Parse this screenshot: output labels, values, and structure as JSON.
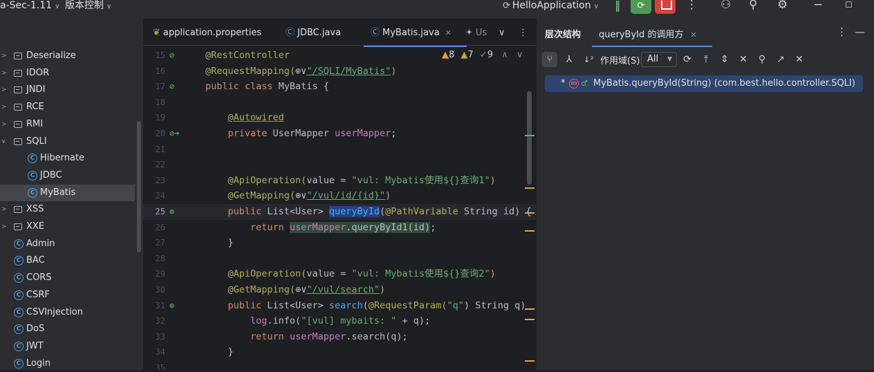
{
  "titlebar": {
    "project": "a-Sec-1.11",
    "vcs": "版本控制",
    "run_config": "HelloApplication",
    "icons": [
      "run-config-icon",
      "pause-icon",
      "debug-icon",
      "stop-icon",
      "more-icon",
      "add-user-icon",
      "search-icon",
      "settings-icon",
      "minimize-icon",
      "maximize-icon"
    ]
  },
  "project_tree": [
    {
      "label": "Deserialize",
      "type": "folder",
      "indent": 1,
      "expanded": false
    },
    {
      "label": "IDOR",
      "type": "folder",
      "indent": 1,
      "expanded": false
    },
    {
      "label": "JNDI",
      "type": "folder",
      "indent": 1,
      "expanded": false
    },
    {
      "label": "RCE",
      "type": "folder",
      "indent": 1,
      "expanded": false
    },
    {
      "label": "RMI",
      "type": "folder",
      "indent": 1,
      "expanded": false
    },
    {
      "label": "SQLI",
      "type": "folder",
      "indent": 1,
      "expanded": true
    },
    {
      "label": "Hibernate",
      "type": "class",
      "indent": 2
    },
    {
      "label": "JDBC",
      "type": "class",
      "indent": 2
    },
    {
      "label": "MyBatis",
      "type": "class",
      "indent": 2,
      "selected": true
    },
    {
      "label": "XSS",
      "type": "folder",
      "indent": 1,
      "expanded": false
    },
    {
      "label": "XXE",
      "type": "folder",
      "indent": 1,
      "expanded": false
    },
    {
      "label": "Admin",
      "type": "class",
      "indent": 1
    },
    {
      "label": "BAC",
      "type": "class",
      "indent": 1
    },
    {
      "label": "CORS",
      "type": "class",
      "indent": 1
    },
    {
      "label": "CSRF",
      "type": "class",
      "indent": 1
    },
    {
      "label": "CSVInjection",
      "type": "class",
      "indent": 1
    },
    {
      "label": "DoS",
      "type": "class",
      "indent": 1
    },
    {
      "label": "JWT",
      "type": "class",
      "indent": 1
    },
    {
      "label": "Login",
      "type": "class",
      "indent": 1
    }
  ],
  "editor": {
    "tabs": [
      {
        "label": "application.properties",
        "icon": "spring-icon"
      },
      {
        "label": "JDBC.java",
        "icon": "class-icon"
      },
      {
        "label": "MyBatis.java",
        "icon": "class-icon",
        "active": true
      },
      {
        "label": "Us",
        "icon": "class-icon"
      }
    ],
    "inspections": {
      "warnings": "8",
      "weak_warnings": "7",
      "typos": "9"
    },
    "current_line": "25",
    "lines": [
      {
        "n": "15",
        "gutter": "bean-icon"
      },
      {
        "n": "16",
        "gutter": ""
      },
      {
        "n": "17",
        "gutter": "bean-icon"
      },
      {
        "n": "18",
        "gutter": ""
      },
      {
        "n": "19",
        "gutter": ""
      },
      {
        "n": "20",
        "gutter": "bean-autowire-icon"
      },
      {
        "n": "21",
        "gutter": ""
      },
      {
        "n": "22",
        "gutter": ""
      },
      {
        "n": "23",
        "gutter": ""
      },
      {
        "n": "24",
        "gutter": ""
      },
      {
        "n": "25",
        "gutter": "endpoint-icon"
      },
      {
        "n": "26",
        "gutter": ""
      },
      {
        "n": "27",
        "gutter": ""
      },
      {
        "n": "28",
        "gutter": ""
      },
      {
        "n": "29",
        "gutter": ""
      },
      {
        "n": "30",
        "gutter": ""
      },
      {
        "n": "31",
        "gutter": "endpoint-icon"
      },
      {
        "n": "32",
        "gutter": ""
      },
      {
        "n": "33",
        "gutter": ""
      },
      {
        "n": "34",
        "gutter": ""
      },
      {
        "n": "35",
        "gutter": ""
      }
    ],
    "code": {
      "l15": "@RestController",
      "l16_a": "@RequestMapping(",
      "l16_b": "\"/SQLI/MyBatis\"",
      "l16_c": ")",
      "l17_a": "public class ",
      "l17_b": "MyBatis {",
      "l19": "@Autowired",
      "l20_a": "private ",
      "l20_b": "UserMapper ",
      "l20_c": "userMapper",
      "l20_d": ";",
      "l23_a": "@ApiOperation(",
      "l23_b": "value = ",
      "l23_c": "\"vul: Mybatis使用${}查询1\"",
      "l23_d": ")",
      "l24_a": "@GetMapping(",
      "l24_b": "\"/vul/id/{id}\"",
      "l24_c": ")",
      "l25_a": "public ",
      "l25_b": "List<User> ",
      "l25_c": "queryById",
      "l25_d": "(",
      "l25_e": "@PathVariable ",
      "l25_f": "String id) {",
      "l26_a": "return ",
      "l26_b": "userMapper",
      "l26_c": ".queryById1(id)",
      "l26_d": ";",
      "l27": "}",
      "l29_a": "@ApiOperation(",
      "l29_b": "value = ",
      "l29_c": "\"vul: Mybatis使用${}查询2\"",
      "l29_d": ")",
      "l30_a": "@GetMapping(",
      "l30_b": "\"/vul/search\"",
      "l30_c": ")",
      "l31_a": "public ",
      "l31_b": "List<User> ",
      "l31_c": "search",
      "l31_d": "(",
      "l31_e": "@RequestParam(",
      "l31_f": "\"q\"",
      "l31_g": ") String q)",
      "l32_a": "log",
      "l32_b": ".info(",
      "l32_c": "\"[vul] mybaits: \"",
      "l32_d": " + q);",
      "l33_a": "return ",
      "l33_b": "userMapper",
      "l33_c": ".search(q);",
      "l34": "}"
    }
  },
  "hierarchy_panel": {
    "title": "层次结构",
    "tab": "queryById 的调用方",
    "scope_label": "作用域(S):",
    "scope_value": "All",
    "result_star": "*",
    "result_text": "MyBatis.queryById(String)  (com.best.hello.controller.SQLI)",
    "toolbar_icons": [
      "caller-hierarchy-icon",
      "callee-hierarchy-icon",
      "sort-alpha-icon",
      "refresh-icon",
      "expand-all-icon",
      "expand-icon",
      "collapse-icon",
      "pin-icon",
      "export-icon",
      "close-icon"
    ]
  }
}
